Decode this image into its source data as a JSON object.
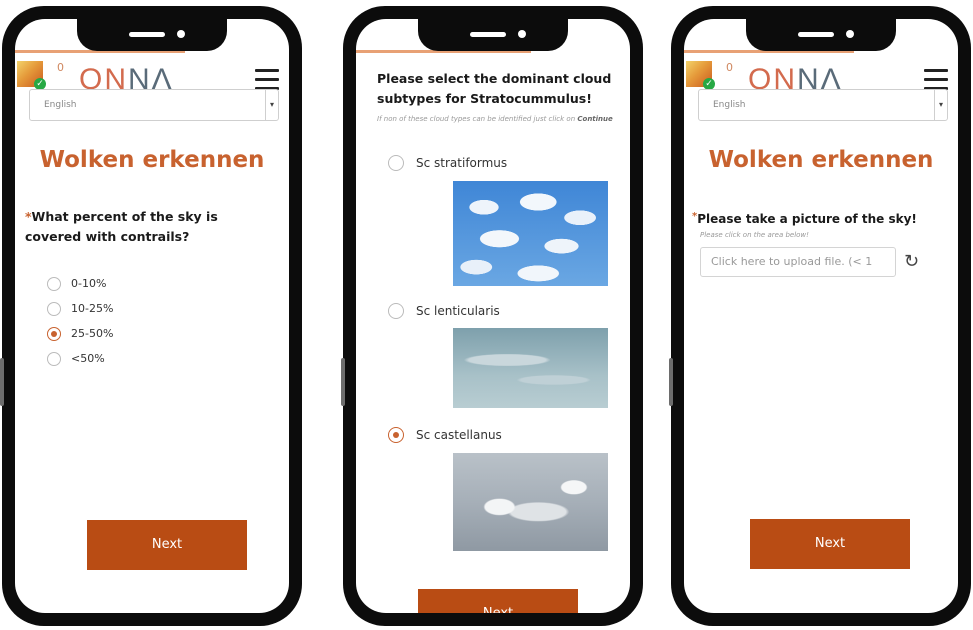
{
  "left_phone": {
    "points": "0",
    "logo": {
      "part1": "ON",
      "part2": "N",
      "part3": "Λ"
    },
    "language": "English",
    "title": "Wolken erkennen",
    "question": "What percent of the sky is covered with contrails?",
    "required_mark": "*",
    "options": [
      "0-10%",
      "10-25%",
      "25-50%",
      "<50%"
    ],
    "selected": "25-50%",
    "next_label": "Next"
  },
  "middle_phone": {
    "title": "Please select the dominant cloud subtypes for Stratocummulus!",
    "hint_prefix": "If non of these cloud types can be identified just click on",
    "hint_link": "Continue",
    "options": [
      "Sc stratiformus",
      "Sc lenticularis",
      "Sc castellanus"
    ],
    "selected": "Sc castellanus",
    "next_label": "Next"
  },
  "right_phone": {
    "points": "0",
    "language": "English",
    "title": "Wolken erkennen",
    "question": "Please take a picture of the sky!",
    "required_mark": "*",
    "hint": "Please click on the area below!",
    "upload_placeholder": "Click here to upload file. (< 1",
    "next_label": "Next"
  },
  "colors": {
    "accent": "#c8622f",
    "button": "#b94c14",
    "phone_frame": "#0c0c0c"
  },
  "icons": [
    "badge-icon",
    "check-icon",
    "menu-icon",
    "chevron-down-icon",
    "refresh-icon"
  ]
}
